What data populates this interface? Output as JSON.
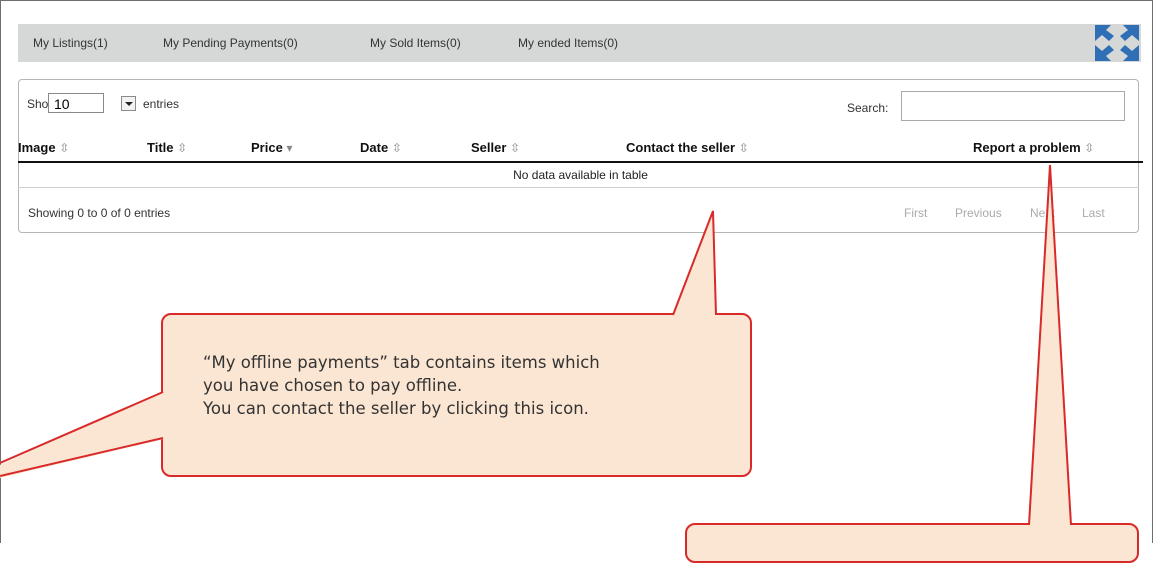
{
  "tabs": [
    {
      "label": "My Listings(1)"
    },
    {
      "label": "My Pending Payments(0)"
    },
    {
      "label": "My Sold Items(0)"
    },
    {
      "label": "My ended Items(0)"
    }
  ],
  "expand_icon": "expand-arrows-icon",
  "length_menu": {
    "show_label": "Show",
    "value": "10",
    "entries_label": "entries"
  },
  "search": {
    "label": "Search:",
    "value": ""
  },
  "columns": [
    {
      "label": "Image",
      "sort": "⇳"
    },
    {
      "label": "Title",
      "sort": "⇳"
    },
    {
      "label": "Price",
      "sort": "▾"
    },
    {
      "label": "Date",
      "sort": "⇳"
    },
    {
      "label": "Seller",
      "sort": "⇳"
    },
    {
      "label": "Contact the seller",
      "sort": "⇳"
    },
    {
      "label": "Report a problem",
      "sort": "⇳"
    }
  ],
  "empty_message": "No data available in table",
  "info": "Showing 0 to 0 of 0 entries",
  "pagination": {
    "first": "First",
    "previous": "Previous",
    "next": "Next",
    "last": "Last"
  },
  "callout": {
    "line1": "“My offline payments” tab contains items which",
    "line2": "you have chosen to pay offline.",
    "line3": "You can contact the seller by clicking this icon."
  },
  "colors": {
    "accent_red": "#d92a2a",
    "callout_bg": "#fbe6d3",
    "expand_icon": "#2f6fb5"
  }
}
